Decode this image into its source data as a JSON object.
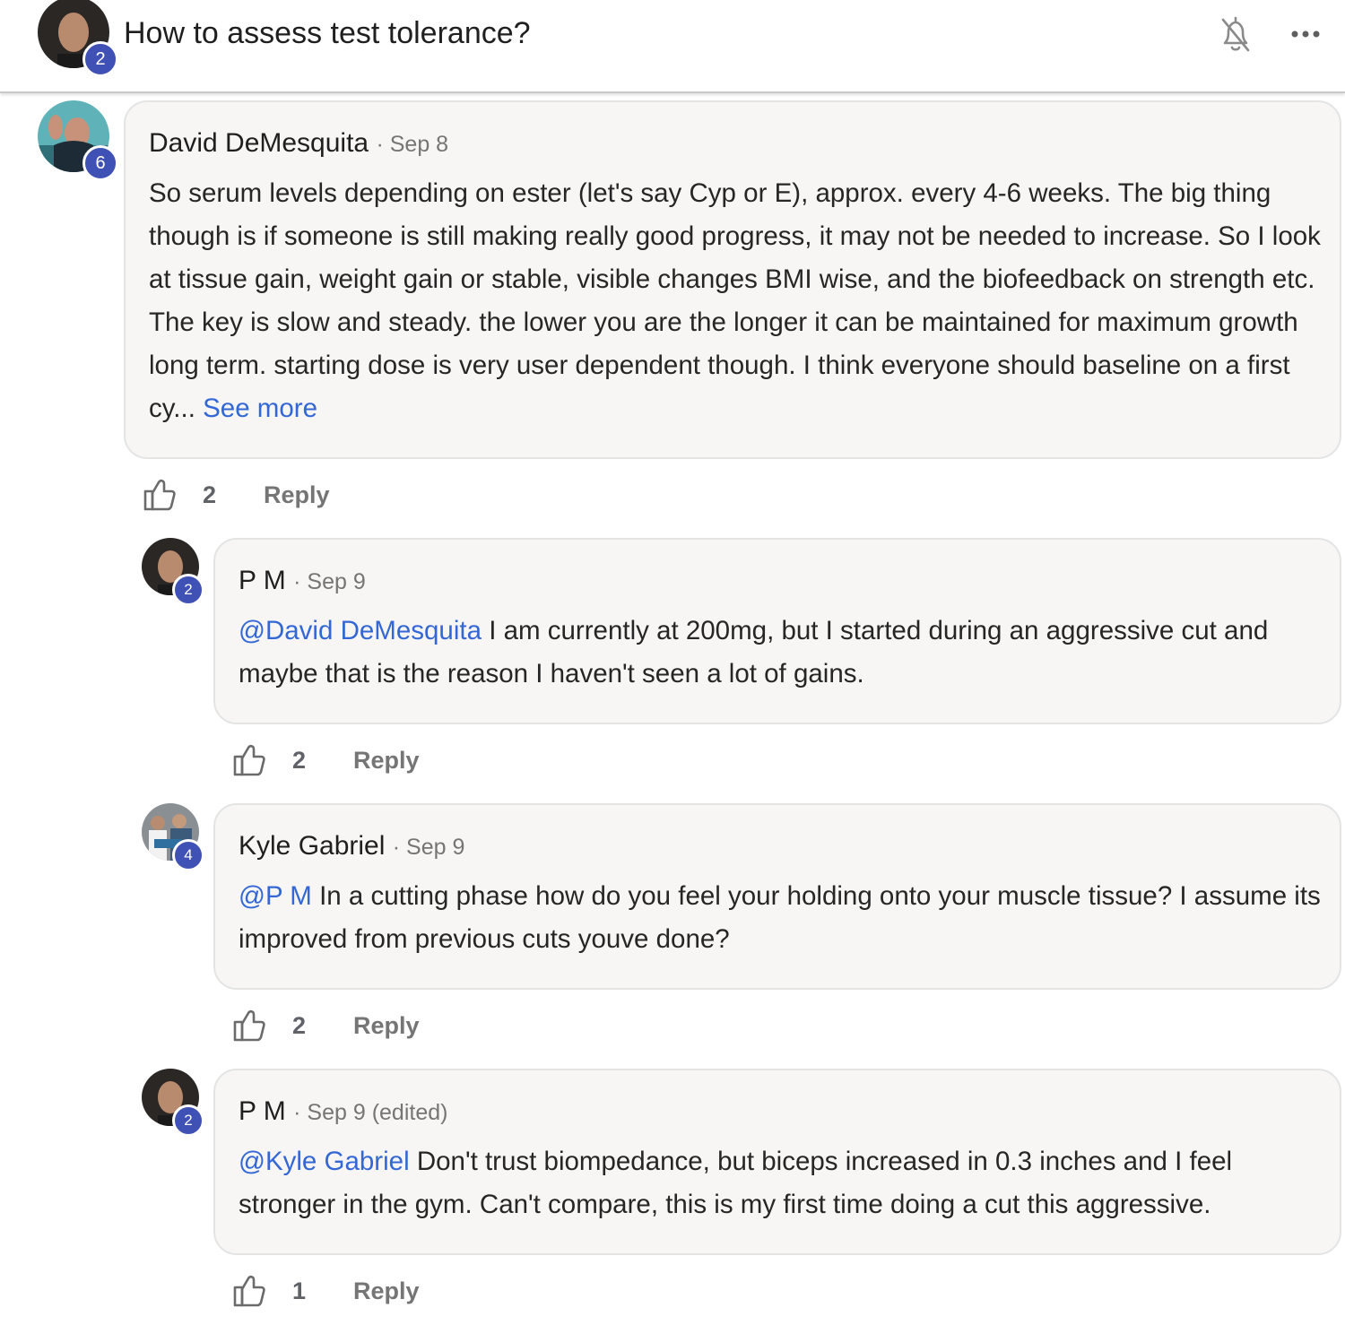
{
  "header": {
    "title": "How to assess test tolerance?",
    "avatar_badge": "2"
  },
  "comments": [
    {
      "author": "David DeMesquita",
      "date": "· Sep 8",
      "avatar_badge": "6",
      "text": "So serum levels depending on ester (let's say Cyp or E), approx. every 4-6 weeks. The big thing though is if someone is still making really good progress, it may not be needed to increase. So I look at tissue gain, weight gain or stable, visible changes BMI wise, and the biofeedback on strength etc. The key is slow and steady. the lower you are the longer it can be maintained for maximum growth long term. starting dose is very user dependent though. I think everyone should baseline on a first cy...",
      "see_more": "See more",
      "likes": "2",
      "reply_label": "Reply"
    },
    {
      "author": "P M",
      "date": "· Sep 9",
      "avatar_badge": "2",
      "mention": "@David DeMesquita",
      "text": "I am currently at 200mg, but I started during an aggressive cut and maybe that is the reason I haven't seen a lot of gains.",
      "likes": "2",
      "reply_label": "Reply"
    },
    {
      "author": "Kyle Gabriel",
      "date": "· Sep 9",
      "avatar_badge": "4",
      "mention": "@P M",
      "text": "In a cutting phase how do you feel your holding onto your muscle tissue? I assume its improved from previous cuts youve done?",
      "likes": "2",
      "reply_label": "Reply"
    },
    {
      "author": "P M",
      "date": "· Sep 9 (edited)",
      "avatar_badge": "2",
      "mention": "@Kyle Gabriel",
      "text": "Don't trust biompedance, but biceps increased in 0.3 inches and I feel stronger in the gym. Can't compare, this is my first time doing a cut this aggressive.",
      "likes": "1",
      "reply_label": "Reply"
    }
  ],
  "colors": {
    "badge": "#3f51b5",
    "link": "#3367d6",
    "bubble_bg": "#f7f6f5",
    "meta": "#757575"
  },
  "icons": [
    "bell-off-icon",
    "more-horizontal-icon",
    "thumbs-up-icon"
  ]
}
